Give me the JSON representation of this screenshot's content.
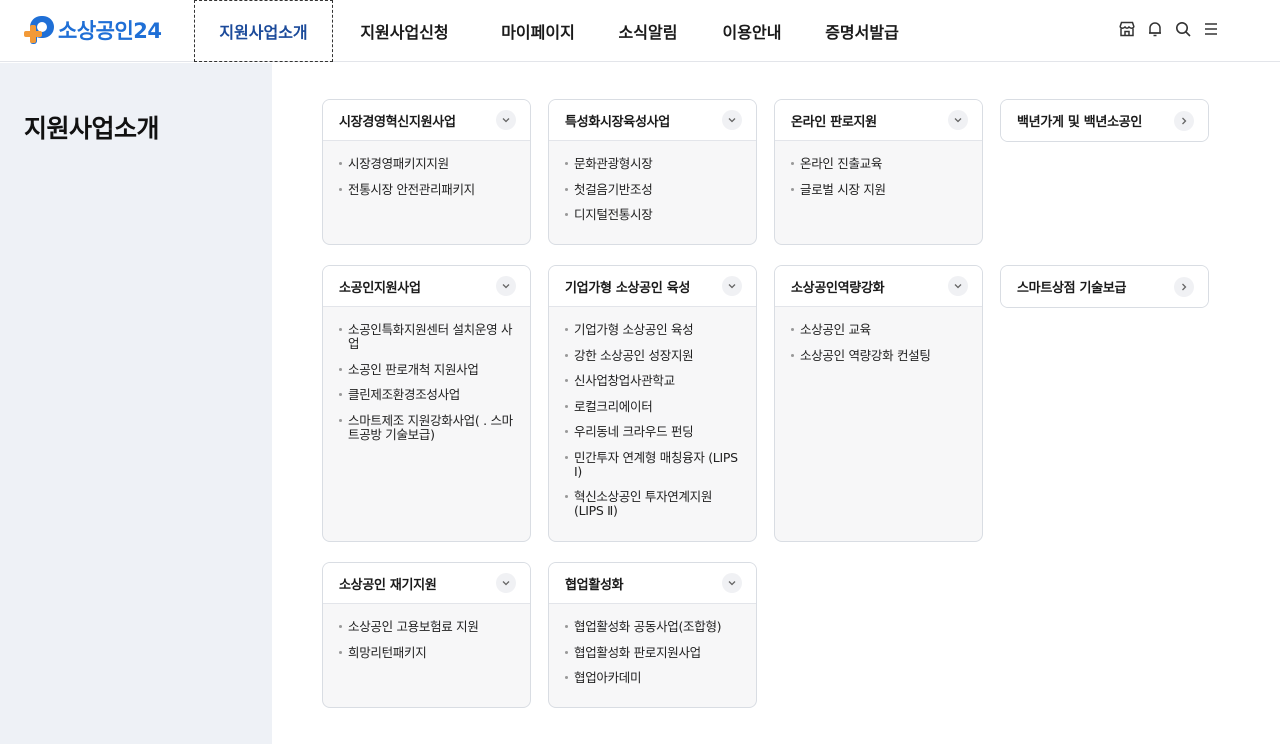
{
  "header": {
    "logo_text": "소상공인24",
    "nav": [
      {
        "label": "지원사업소개",
        "active": true
      },
      {
        "label": "지원사업신청",
        "active": false
      },
      {
        "label": "마이페이지",
        "active": false
      },
      {
        "label": "소식알림",
        "active": false
      },
      {
        "label": "이용안내",
        "active": false
      },
      {
        "label": "증명서발급",
        "active": false
      }
    ],
    "tools": [
      "store-icon",
      "bell-icon",
      "search-icon",
      "menu-icon"
    ]
  },
  "side": {
    "title": "지원사업소개"
  },
  "colors": {
    "brand_blue": "#1f6fd6",
    "brand_orange": "#f29a38",
    "active_nav": "#1b4a9a",
    "side_bg": "#eef1f6"
  },
  "cards": [
    {
      "title": "시장경영혁신지원사업",
      "icon": "chevron-down-icon",
      "items": [
        "시장경영패키지지원",
        "전통시장 안전관리패키지"
      ]
    },
    {
      "title": "특성화시장육성사업",
      "icon": "chevron-down-icon",
      "items": [
        "문화관광형시장",
        "첫걸음기반조성",
        "디지털전통시장"
      ]
    },
    {
      "title": "온라인 판로지원",
      "icon": "chevron-down-icon",
      "items": [
        "온라인 진출교육",
        "글로벌 시장 지원"
      ]
    },
    {
      "title": "백년가게 및 백년소공인",
      "icon": "chevron-right-icon",
      "items": []
    },
    {
      "title": "소공인지원사업",
      "icon": "chevron-down-icon",
      "items": [
        "소공인특화지원센터 설치운영 사업",
        "소공인 판로개척 지원사업",
        "클린제조환경조성사업",
        "스마트제조 지원강화사업( . 스마트공방 기술보급)"
      ]
    },
    {
      "title": "기업가형 소상공인 육성",
      "icon": "chevron-down-icon",
      "items": [
        "기업가형 소상공인 육성",
        "강한 소상공인 성장지원",
        "신사업창업사관학교",
        "로컬크리에이터",
        "우리동네 크라우드 펀딩",
        "민간투자 연계형 매칭융자 (LIPS Ⅰ)",
        "혁신소상공인 투자연계지원 (LIPS Ⅱ)"
      ]
    },
    {
      "title": "소상공인역량강화",
      "icon": "chevron-down-icon",
      "items": [
        "소상공인 교육",
        "소상공인 역량강화 컨설팅"
      ]
    },
    {
      "title": "스마트상점 기술보급",
      "icon": "chevron-right-icon",
      "items": []
    },
    {
      "title": "소상공인 재기지원",
      "icon": "chevron-down-icon",
      "items": [
        "소상공인 고용보험료 지원",
        "희망리턴패키지"
      ]
    },
    {
      "title": "협업활성화",
      "icon": "chevron-down-icon",
      "items": [
        "협업활성화 공동사업(조합형)",
        "협업활성화 판로지원사업",
        "협업아카데미"
      ]
    }
  ]
}
